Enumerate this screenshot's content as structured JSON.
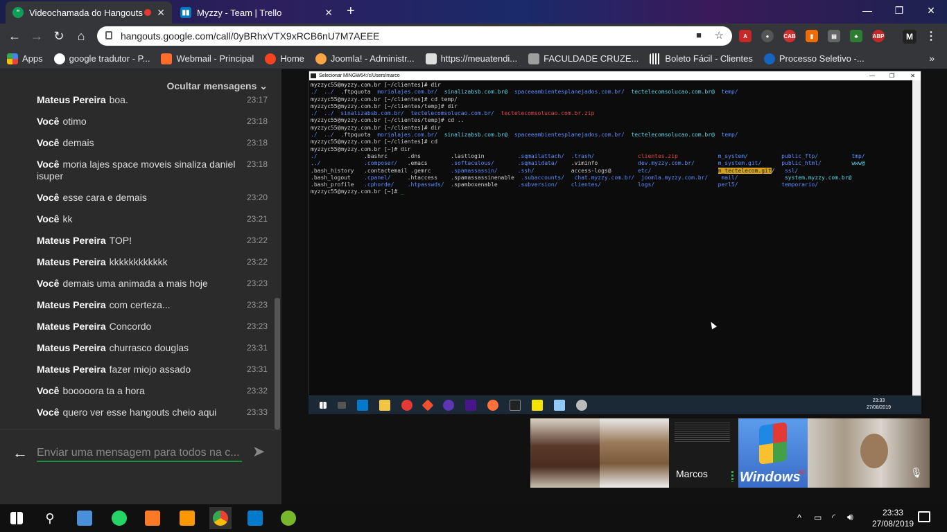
{
  "tabs": [
    {
      "title": "Videochamada do Hangouts",
      "icon": "hangouts-icon"
    },
    {
      "title": "Myzzy - Team | Trello",
      "icon": "trello-icon"
    }
  ],
  "url": "hangouts.google.com/call/0yBRhxVTX9xRCB6nU7M7AEEE",
  "bookmarks": [
    {
      "label": "Apps",
      "icon": "apps-icon"
    },
    {
      "label": "google tradutor - P...",
      "icon": "google-icon"
    },
    {
      "label": "Webmail - Principal",
      "icon": "cpanel-icon"
    },
    {
      "label": "Home",
      "icon": "joomla-icon"
    },
    {
      "label": "Joomla! - Administr...",
      "icon": "joomla-icon"
    },
    {
      "label": "https://meuatendi...",
      "icon": "page-icon"
    },
    {
      "label": "FACULDADE CRUZE...",
      "icon": "faculdade-icon"
    },
    {
      "label": "Boleto Fácil - Clientes",
      "icon": "barcode-icon"
    },
    {
      "label": "Processo Seletivo -...",
      "icon": "globe-icon"
    }
  ],
  "chat": {
    "hide_label": "Ocultar mensagens",
    "input_placeholder": "Enviar uma mensagem para todos na c...",
    "messages": [
      {
        "sender": "Mateus Pereira",
        "text": "boa.",
        "time": "23:17"
      },
      {
        "sender": "Você",
        "text": "otimo",
        "time": "23:18"
      },
      {
        "sender": "Você",
        "text": "demais",
        "time": "23:18"
      },
      {
        "sender": "Você",
        "text": "moria lajes space moveis sinaliza daniel isuper",
        "time": "23:18"
      },
      {
        "sender": "Você",
        "text": "esse cara e demais",
        "time": "23:20"
      },
      {
        "sender": "Você",
        "text": "kk",
        "time": "23:21"
      },
      {
        "sender": "Mateus Pereira",
        "text": "TOP!",
        "time": "23:22"
      },
      {
        "sender": "Mateus Pereira",
        "text": "kkkkkkkkkkkk",
        "time": "23:22"
      },
      {
        "sender": "Você",
        "text": "demais uma animada a mais hoje",
        "time": "23:23"
      },
      {
        "sender": "Mateus Pereira",
        "text": "com certeza...",
        "time": "23:23"
      },
      {
        "sender": "Mateus Pereira",
        "text": "Concordo",
        "time": "23:23"
      },
      {
        "sender": "Mateus Pereira",
        "text": "churrasco douglas",
        "time": "23:31"
      },
      {
        "sender": "Mateus Pereira",
        "text": "fazer miojo assado",
        "time": "23:31"
      },
      {
        "sender": "Você",
        "text": "booooora ta a hora",
        "time": "23:32"
      },
      {
        "sender": "Você",
        "text": "quero ver esse hangouts cheio aqui",
        "time": "23:33"
      }
    ]
  },
  "terminal": {
    "title": "Selecionar MINGW64:/c/Users/marco",
    "prompt_dir": "myzzyc55@myzzy.com.br [~/clientes]# dir",
    "remote_time": "23:33",
    "remote_date": "27/08/2019"
  },
  "participants": {
    "marcos_label": "Marcos",
    "windows_label": "Windows",
    "xp_label": "xp"
  },
  "taskbar": {
    "time": "23:33",
    "date": "27/08/2019"
  }
}
